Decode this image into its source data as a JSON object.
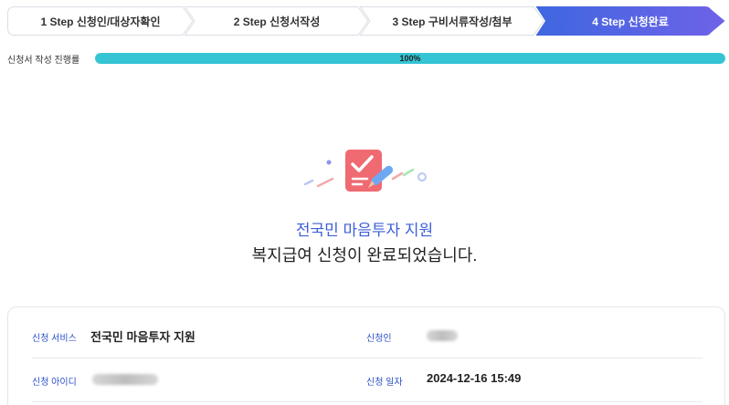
{
  "steps": [
    {
      "label": "1 Step 신청인/대상자확인",
      "active": false
    },
    {
      "label": "2 Step 신청서작성",
      "active": false
    },
    {
      "label": "3 Step 구비서류작성/첨부",
      "active": false
    },
    {
      "label": "4 Step 신청완료",
      "active": true
    }
  ],
  "progress": {
    "label": "신청서 작성 진행률",
    "value": 100,
    "text": "100%"
  },
  "completion": {
    "service_title": "전국민 마음투자 지원",
    "message": "복지급여 신청이 완료되었습니다."
  },
  "info": {
    "service_label": "신청 서비스",
    "service_value": "전국민 마음투자 지원",
    "applicant_label": "신청인",
    "applicant_id_label": "신청 아이디",
    "date_label": "신청 일자",
    "date_value": "2024-12-16 15:49"
  },
  "colors": {
    "accent": "#3d5fd6",
    "progress": "#34c4d4",
    "step_active_start": "#3f67e0",
    "step_active_end": "#6e62e8"
  }
}
